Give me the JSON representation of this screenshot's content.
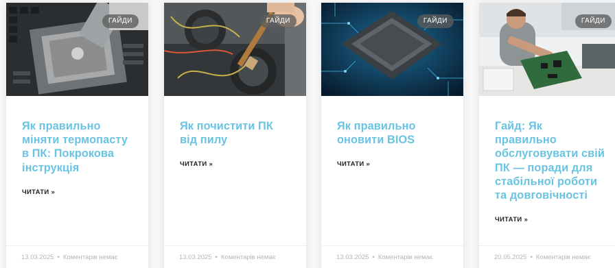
{
  "cards": [
    {
      "category": "ГАЙДИ",
      "title": "Як правильно міняти термопасту в ПК: Покрокова інструкція",
      "read_more": "ЧИТАТИ »",
      "date": "13.03.2025",
      "separator": "•",
      "comments": "Коментарів немає",
      "image_icon": "thermal-paste-cpu-photo"
    },
    {
      "category": "ГАЙДИ",
      "title": "Як почистити ПК від пилу",
      "read_more": "ЧИТАТИ »",
      "date": "13.03.2025",
      "separator": "•",
      "comments": "Коментарів немає",
      "image_icon": "pc-dust-cleaning-photo"
    },
    {
      "category": "ГАЙДИ",
      "title": "Як правильно оновити BIOS",
      "read_more": "ЧИТАТИ »",
      "date": "13.03.2025",
      "separator": "•",
      "comments": "Коментарів немає",
      "image_icon": "bios-chip-illustration"
    },
    {
      "category": "ГАЙДИ",
      "title": "Гайд: Як правильно обслуговувати свій ПК — поради для стабільної роботи та довговічності",
      "read_more": "ЧИТАТИ »",
      "date": "20.05.2025",
      "separator": "•",
      "comments": "Коментарів немає",
      "image_icon": "technician-repair-photo"
    }
  ],
  "colors": {
    "title": "#69c3e3",
    "badge_bg": "#5c5c5c",
    "meta_text": "#b5b5b5",
    "page_bg": "#f7f7f7"
  }
}
